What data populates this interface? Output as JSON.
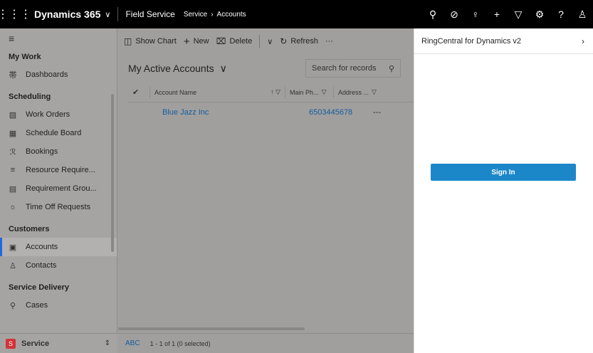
{
  "topbar": {
    "app_name": "Dynamics 365",
    "area": "Field Service",
    "breadcrumb": [
      "Service",
      "Accounts"
    ]
  },
  "sidebar": {
    "sections": [
      {
        "title": "My Work",
        "items": [
          {
            "label": "Dashboards",
            "icon": "dashboard-icon",
            "glyph": "帯"
          }
        ]
      },
      {
        "title": "Scheduling",
        "items": [
          {
            "label": "Work Orders",
            "icon": "work-order-icon",
            "glyph": "▨"
          },
          {
            "label": "Schedule Board",
            "icon": "calendar-icon",
            "glyph": "▦"
          },
          {
            "label": "Bookings",
            "icon": "bookings-icon",
            "glyph": "ℛ"
          },
          {
            "label": "Resource Require...",
            "icon": "resource-requirement-icon",
            "glyph": "≡"
          },
          {
            "label": "Requirement Grou...",
            "icon": "requirement-group-icon",
            "glyph": "▤"
          },
          {
            "label": "Time Off Requests",
            "icon": "time-off-icon",
            "glyph": "☼"
          }
        ]
      },
      {
        "title": "Customers",
        "items": [
          {
            "label": "Accounts",
            "icon": "accounts-icon",
            "glyph": "▣",
            "active": true
          },
          {
            "label": "Contacts",
            "icon": "contacts-icon",
            "glyph": "♙"
          }
        ]
      },
      {
        "title": "Service Delivery",
        "items": [
          {
            "label": "Cases",
            "icon": "cases-icon",
            "glyph": "⚲"
          }
        ]
      }
    ],
    "area_switcher": {
      "badge": "S",
      "label": "Service"
    }
  },
  "commandbar": {
    "show_chart": "Show Chart",
    "new": "New",
    "delete": "Delete",
    "refresh": "Refresh",
    "more": "···"
  },
  "view": {
    "title": "My Active Accounts",
    "search_placeholder": "Search for records"
  },
  "grid": {
    "columns": [
      "Account Name",
      "Main Ph...",
      "Address ..."
    ],
    "rows": [
      {
        "name": "Blue Jazz Inc",
        "phone": "6503445678",
        "address": "---"
      }
    ],
    "footer_abc": "ABC",
    "footer_count": "1 - 1 of 1 (0 selected)"
  },
  "panel": {
    "title": "RingCentral for Dynamics v2",
    "sign_in": "Sign In"
  },
  "colors": {
    "accent": "#2266e3",
    "link": "#115ea3",
    "signin": "#1b87c9",
    "overlay": "#a19f9d"
  }
}
